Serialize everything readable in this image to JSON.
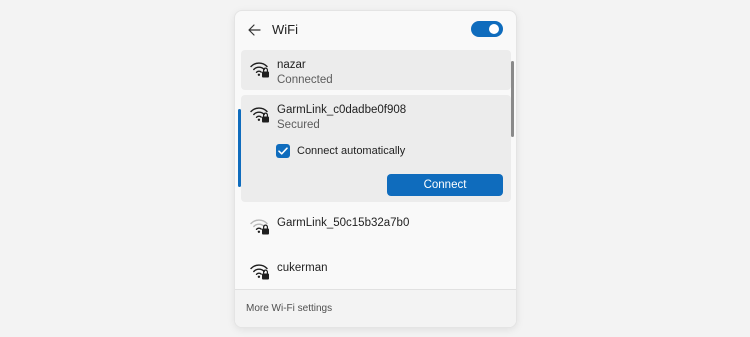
{
  "header": {
    "title": "WiFi",
    "back_icon": "arrow-left-icon",
    "wifi_enabled": true
  },
  "networks": [
    {
      "name": "nazar",
      "status": "Connected",
      "secured": true,
      "signal": "full"
    },
    {
      "name": "GarmLink_c0dadbe0f908",
      "status": "Secured",
      "secured": true,
      "signal": "full",
      "connect_automatically_label": "Connect automatically",
      "connect_automatically": true,
      "connect_label": "Connect"
    },
    {
      "name": "GarmLink_50c15b32a7b0",
      "secured": true,
      "signal": "weak"
    },
    {
      "name": "cukerman",
      "secured": true,
      "signal": "full"
    }
  ],
  "footer": {
    "more_settings_label": "More Wi-Fi settings"
  },
  "colors": {
    "accent": "#0f6cbd"
  }
}
